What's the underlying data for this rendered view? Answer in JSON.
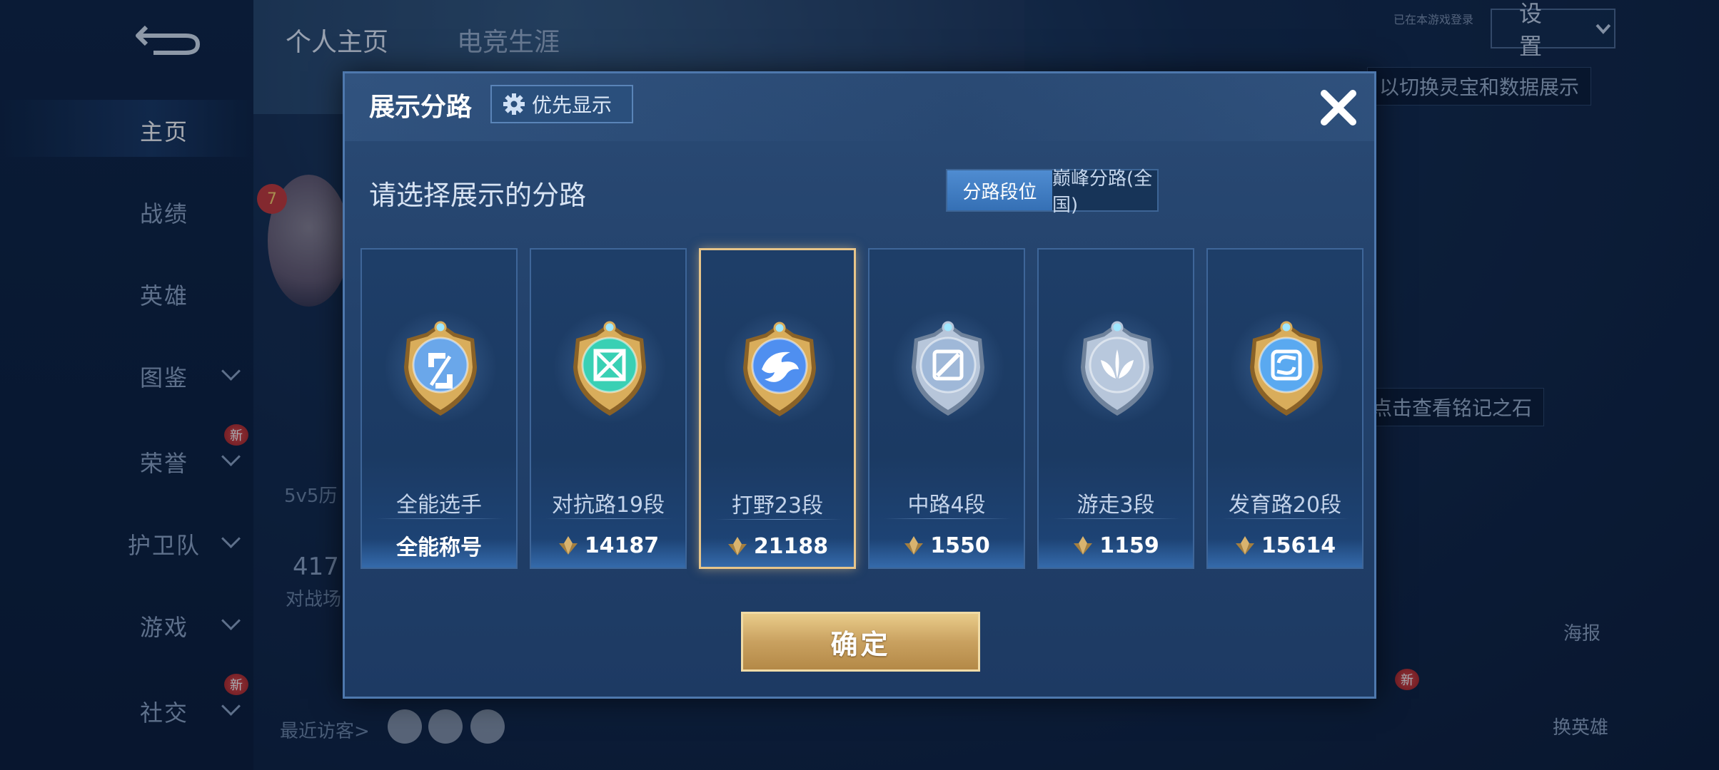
{
  "background": {
    "sidebar_items": [
      {
        "label": "主页",
        "active": true,
        "chevron": false,
        "badge": ""
      },
      {
        "label": "战绩",
        "active": false,
        "chevron": false,
        "badge": ""
      },
      {
        "label": "英雄",
        "active": false,
        "chevron": false,
        "badge": ""
      },
      {
        "label": "图鉴",
        "active": false,
        "chevron": true,
        "badge": ""
      },
      {
        "label": "荣誉",
        "active": false,
        "chevron": true,
        "badge": "新"
      },
      {
        "label": "护卫队",
        "active": false,
        "chevron": true,
        "badge": ""
      },
      {
        "label": "游戏",
        "active": false,
        "chevron": true,
        "badge": ""
      },
      {
        "label": "社交",
        "active": false,
        "chevron": true,
        "badge": "新"
      }
    ],
    "top_tabs": [
      "个人主页",
      "电竞生涯"
    ],
    "settings_label": "设置",
    "settings_note": "已在本游戏登录",
    "tip_switch": "以切换灵宝和数据展示",
    "tip_stone": "点击查看铭记之石",
    "history_label": "5v5历",
    "match_count": "417",
    "match_count_label": "对战场",
    "recent_visitors": "最近访客>",
    "poster_label": "海报",
    "change_hero_label": "换英雄",
    "level_badge": "7",
    "new_badge": "新"
  },
  "modal": {
    "title": "展示分路",
    "priority_button": "优先显示",
    "subtitle": "请选择展示的分路",
    "toggle_options": [
      {
        "label": "分路段位",
        "active": true
      },
      {
        "label": "巅峰分路(全国)",
        "active": false
      }
    ],
    "cards": [
      {
        "lane": "全能选手",
        "value": "全能称号",
        "show_icon": false,
        "selected": false,
        "emblem": "allround-emblem-icon",
        "accent": "#6aa7ea"
      },
      {
        "lane": "对抗路19段",
        "value": "14187",
        "show_icon": true,
        "selected": false,
        "emblem": "clash-lane-emblem-icon",
        "accent": "#39d0b4"
      },
      {
        "lane": "打野23段",
        "value": "21188",
        "show_icon": true,
        "selected": true,
        "emblem": "jungle-emblem-icon",
        "accent": "#4f8ff0"
      },
      {
        "lane": "中路4段",
        "value": "1550",
        "show_icon": true,
        "selected": false,
        "emblem": "mid-lane-emblem-icon",
        "accent": "#9fb8d8"
      },
      {
        "lane": "游走3段",
        "value": "1159",
        "show_icon": true,
        "selected": false,
        "emblem": "roam-emblem-icon",
        "accent": "#b8c8dd"
      },
      {
        "lane": "发育路20段",
        "value": "15614",
        "show_icon": true,
        "selected": false,
        "emblem": "farm-lane-emblem-icon",
        "accent": "#5aa9f0"
      }
    ],
    "confirm_button": "确定",
    "colors": {
      "gold": "#e7c58a",
      "panel": "#23426c",
      "active_tab": "#3f7ec4"
    }
  }
}
